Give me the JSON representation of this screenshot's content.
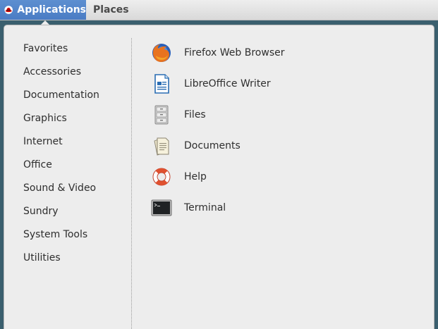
{
  "panel": {
    "applications_label": "Applications",
    "places_label": "Places"
  },
  "categories": [
    {
      "label": "Favorites"
    },
    {
      "label": "Accessories"
    },
    {
      "label": "Documentation"
    },
    {
      "label": "Graphics"
    },
    {
      "label": "Internet"
    },
    {
      "label": "Office"
    },
    {
      "label": "Sound & Video"
    },
    {
      "label": "Sundry"
    },
    {
      "label": "System Tools"
    },
    {
      "label": "Utilities"
    }
  ],
  "favorites": [
    {
      "label": "Firefox Web Browser",
      "icon": "firefox-icon"
    },
    {
      "label": "LibreOffice Writer",
      "icon": "libreoffice-writer-icon"
    },
    {
      "label": "Files",
      "icon": "file-cabinet-icon"
    },
    {
      "label": "Documents",
      "icon": "documents-icon"
    },
    {
      "label": "Help",
      "icon": "lifebuoy-icon"
    },
    {
      "label": "Terminal",
      "icon": "terminal-icon"
    }
  ],
  "colors": {
    "accent": "#4a7cc4",
    "menu_background": "#ededed",
    "desktop": "#3a5f6e"
  }
}
